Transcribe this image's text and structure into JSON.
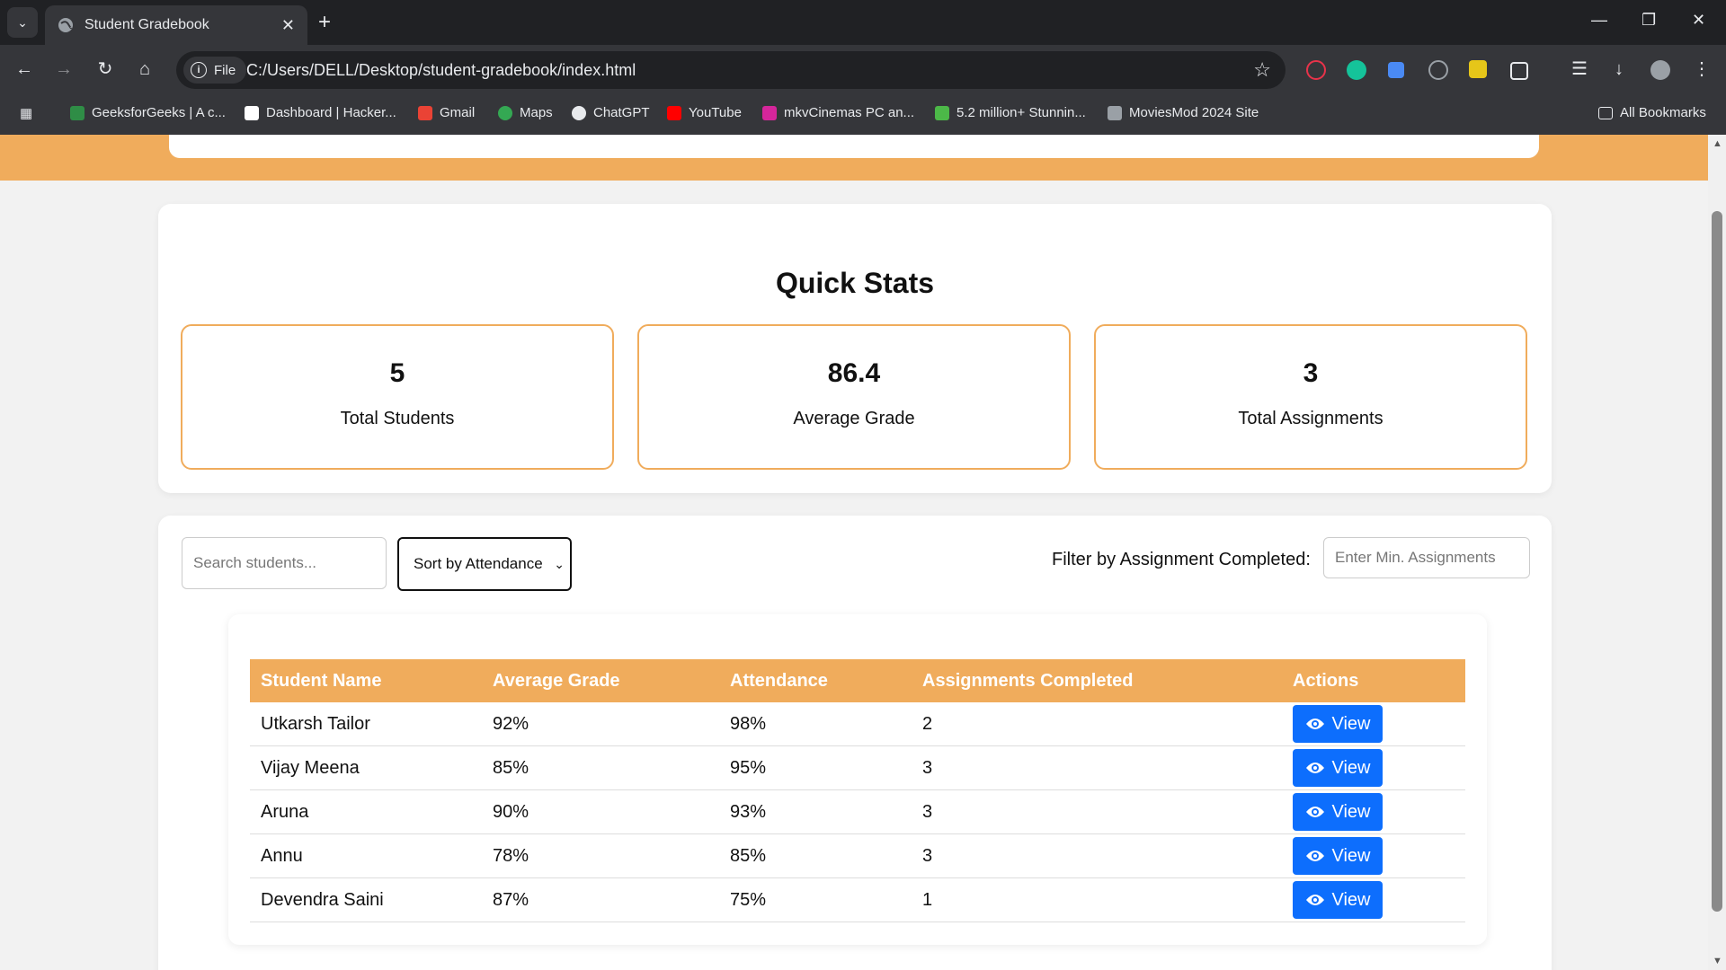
{
  "browser": {
    "tab_title": "Student Gradebook",
    "file_chip": "File",
    "url": "C:/Users/DELL/Desktop/student-gradebook/index.html",
    "bookmarks": [
      {
        "label": "GeeksforGeeks | A c...",
        "color": "#2f8d46"
      },
      {
        "label": "Dashboard | Hacker...",
        "color": "#ffffff"
      },
      {
        "label": "Gmail",
        "color": "#ea4335"
      },
      {
        "label": "Maps",
        "color": "#34a853"
      },
      {
        "label": "ChatGPT",
        "color": "#e8eaed"
      },
      {
        "label": "YouTube",
        "color": "#ff0000"
      },
      {
        "label": "mkvCinemas PC an...",
        "color": "#d5269b"
      },
      {
        "label": "5.2 million+ Stunnin...",
        "color": "#4cb848"
      },
      {
        "label": "MoviesMod 2024 Site",
        "color": "#9aa0a6"
      }
    ],
    "all_bookmarks": "All Bookmarks"
  },
  "stats": {
    "title": "Quick Stats",
    "items": [
      {
        "value": "5",
        "label": "Total Students"
      },
      {
        "value": "86.4",
        "label": "Average Grade"
      },
      {
        "value": "3",
        "label": "Total Assignments"
      }
    ]
  },
  "controls": {
    "search_placeholder": "Search students...",
    "sort_value": "Sort by Attendance",
    "filter_label": "Filter by Assignment Completed:",
    "min_assign_placeholder": "Enter Min. Assignments"
  },
  "table": {
    "headers": [
      "Student Name",
      "Average Grade",
      "Attendance",
      "Assignments Completed",
      "Actions"
    ],
    "rows": [
      {
        "name": "Utkarsh Tailor",
        "grade": "92%",
        "attendance": "98%",
        "assignments": "2",
        "action": "View"
      },
      {
        "name": "Vijay Meena",
        "grade": "85%",
        "attendance": "95%",
        "assignments": "3",
        "action": "View"
      },
      {
        "name": "Aruna",
        "grade": "90%",
        "attendance": "93%",
        "assignments": "3",
        "action": "View"
      },
      {
        "name": "Annu",
        "grade": "78%",
        "attendance": "85%",
        "assignments": "3",
        "action": "View"
      },
      {
        "name": "Devendra Saini",
        "grade": "87%",
        "attendance": "75%",
        "assignments": "1",
        "action": "View"
      }
    ]
  },
  "colors": {
    "accent": "#f0ac5c",
    "button": "#0d6efd"
  }
}
